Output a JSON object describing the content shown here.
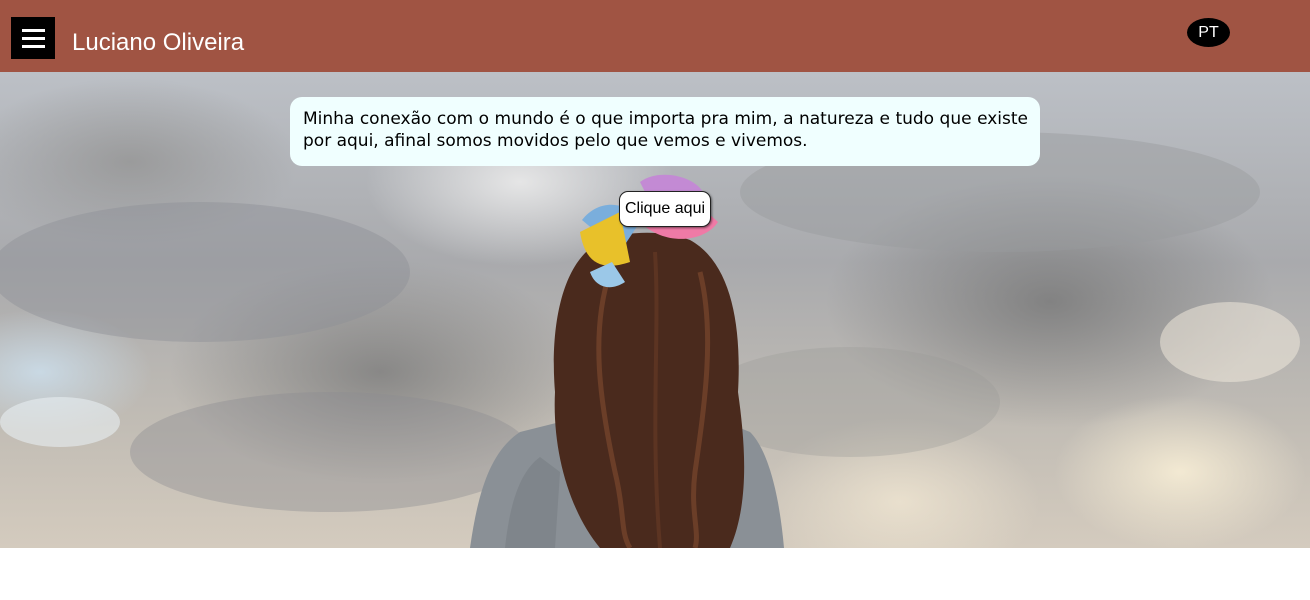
{
  "header": {
    "menu_icon": "hamburger-menu-icon",
    "title": "Luciano Oliveira",
    "language_label": "PT",
    "background_color": "#a05443"
  },
  "hero": {
    "image_description_icon": "girl-looking-at-clouds-photo",
    "quote": "Minha conexão com o mundo é o que importa pra mim, a natureza e tudo que existe por aqui, afinal somos movidos pelo que vemos e vivemos.",
    "quote_background": "#f0ffff",
    "cta_label": "Clique aqui"
  }
}
